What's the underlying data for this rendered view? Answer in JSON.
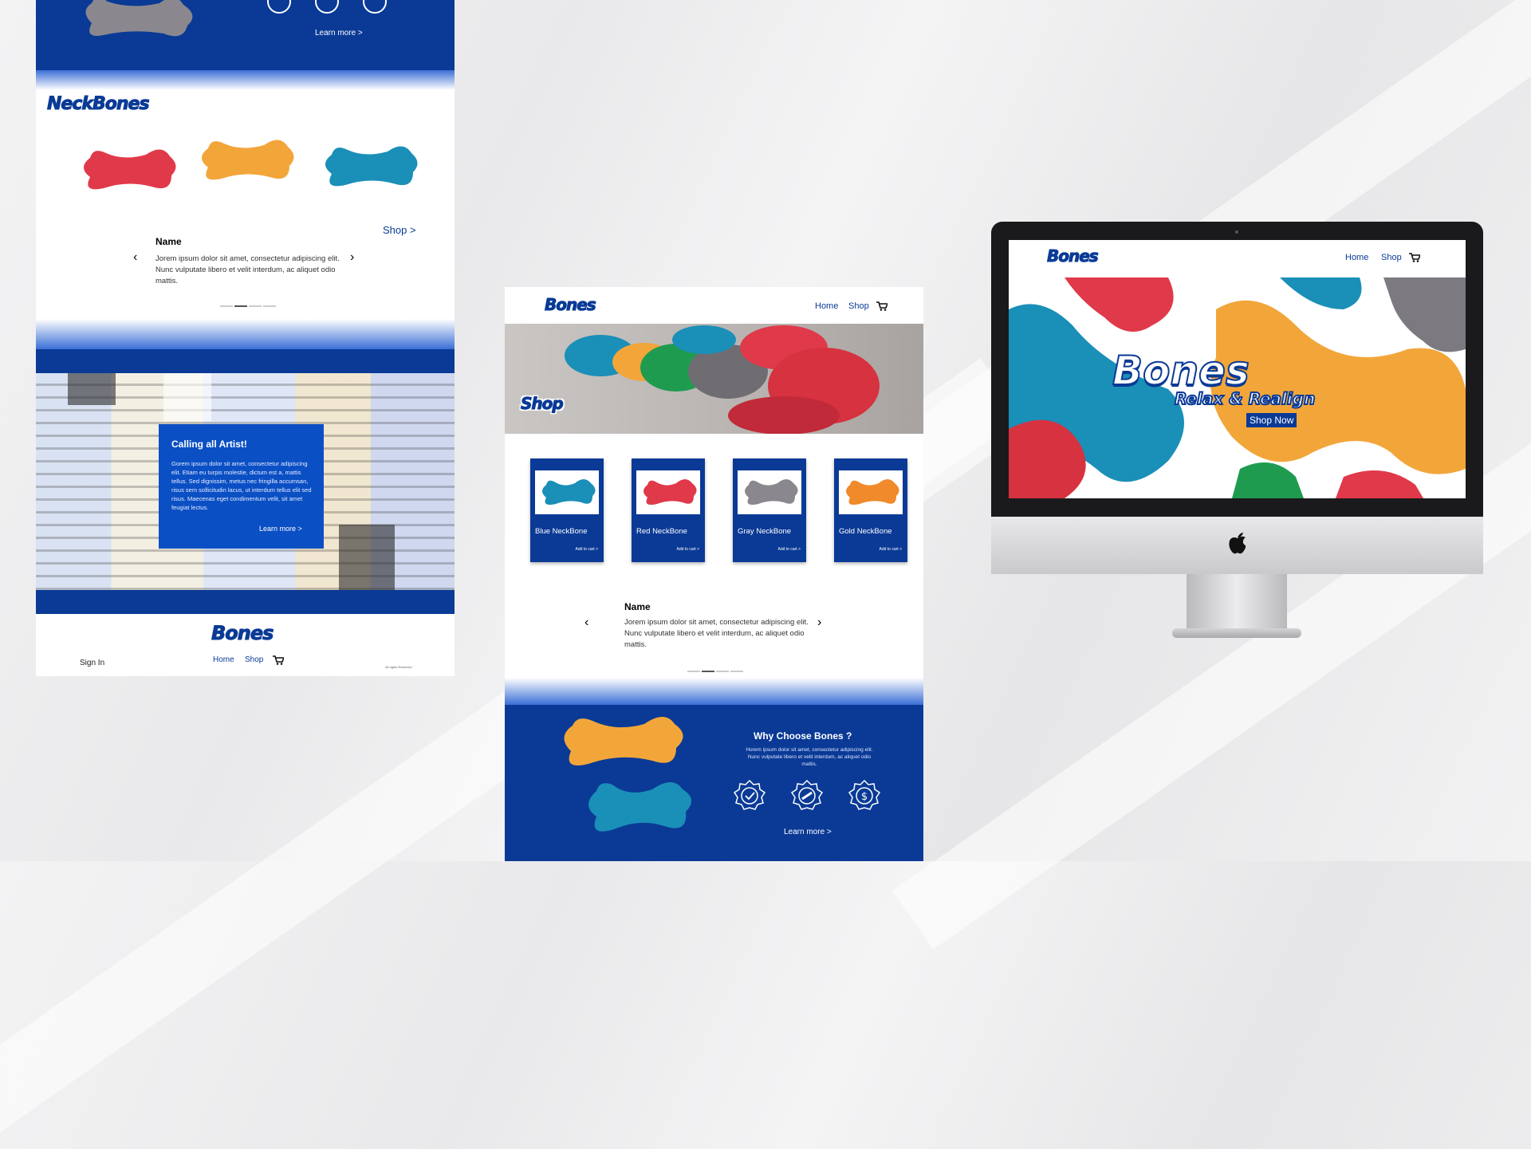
{
  "background": {
    "colors": {
      "brand_blue": "#0a3a96",
      "bright_blue": "#0b4fc4",
      "bone_red": "#e0394a",
      "bone_gold": "#f2a63a",
      "bone_blue": "#1a8fb8",
      "bone_gray": "#7c7a80",
      "bone_green": "#1f9b4f"
    }
  },
  "left_page": {
    "top_link": "Learn more >",
    "section_title": "NeckBones",
    "shop_link": "Shop >",
    "testimonial": {
      "name": "Name",
      "text": "Jorem ipsum dolor sit amet, consectetur adipiscing elit. Nunc vulputate libero et velit interdum, ac aliquet odio mattis."
    },
    "artist_card": {
      "title": "Calling all Artist!",
      "body": "Gorem ipsum dolor sit amet, consectetur adipiscing elit. Etiam eu turpis molestie, dictum est a, mattis tellus. Sed dignissim, metus nec fringilla accumsan, risus sem sollicitudin lacus, ut interdum tellus elit sed risus. Maecenas eget condimentum velit, sit amet feugiat lectus.",
      "link": "Learn more >"
    },
    "footer": {
      "logo": "Bones",
      "sign_in": "Sign In",
      "home": "Home",
      "shop": "Shop",
      "rights": "All rights Reserved"
    }
  },
  "middle_page": {
    "logo": "Bones",
    "nav": {
      "home": "Home",
      "shop": "Shop"
    },
    "hero_title": "Shop",
    "products": [
      {
        "name": "Blue NeckBone",
        "cta": "Add to cart >",
        "color": "#1a8fb8"
      },
      {
        "name": "Red NeckBone",
        "cta": "Add to cart >",
        "color": "#e0394a"
      },
      {
        "name": "Gray NeckBone",
        "cta": "Add to cart >",
        "color": "#8a888e"
      },
      {
        "name": "Gold NeckBone",
        "cta": "Add to cart >",
        "color": "#f08a2a"
      }
    ],
    "testimonial": {
      "name": "Name",
      "text": "Jorem ipsum dolor sit amet, consectetur adipiscing elit. Nunc vulputate libero et velit interdum, ac aliquet odio mattis."
    },
    "why": {
      "title": "Why Choose Bones ?",
      "text": "Horem ipsum dolor sit amet, consectetur adipiscing elit. Nunc vulputate libero et velit interdum, ac aliquet odio mattis.",
      "link": "Learn more >"
    }
  },
  "monitor": {
    "logo": "Bones",
    "nav": {
      "home": "Home",
      "shop": "Shop"
    },
    "hero_logo": "Bones",
    "tagline": "Relax & Realign",
    "cta": "Shop Now"
  }
}
